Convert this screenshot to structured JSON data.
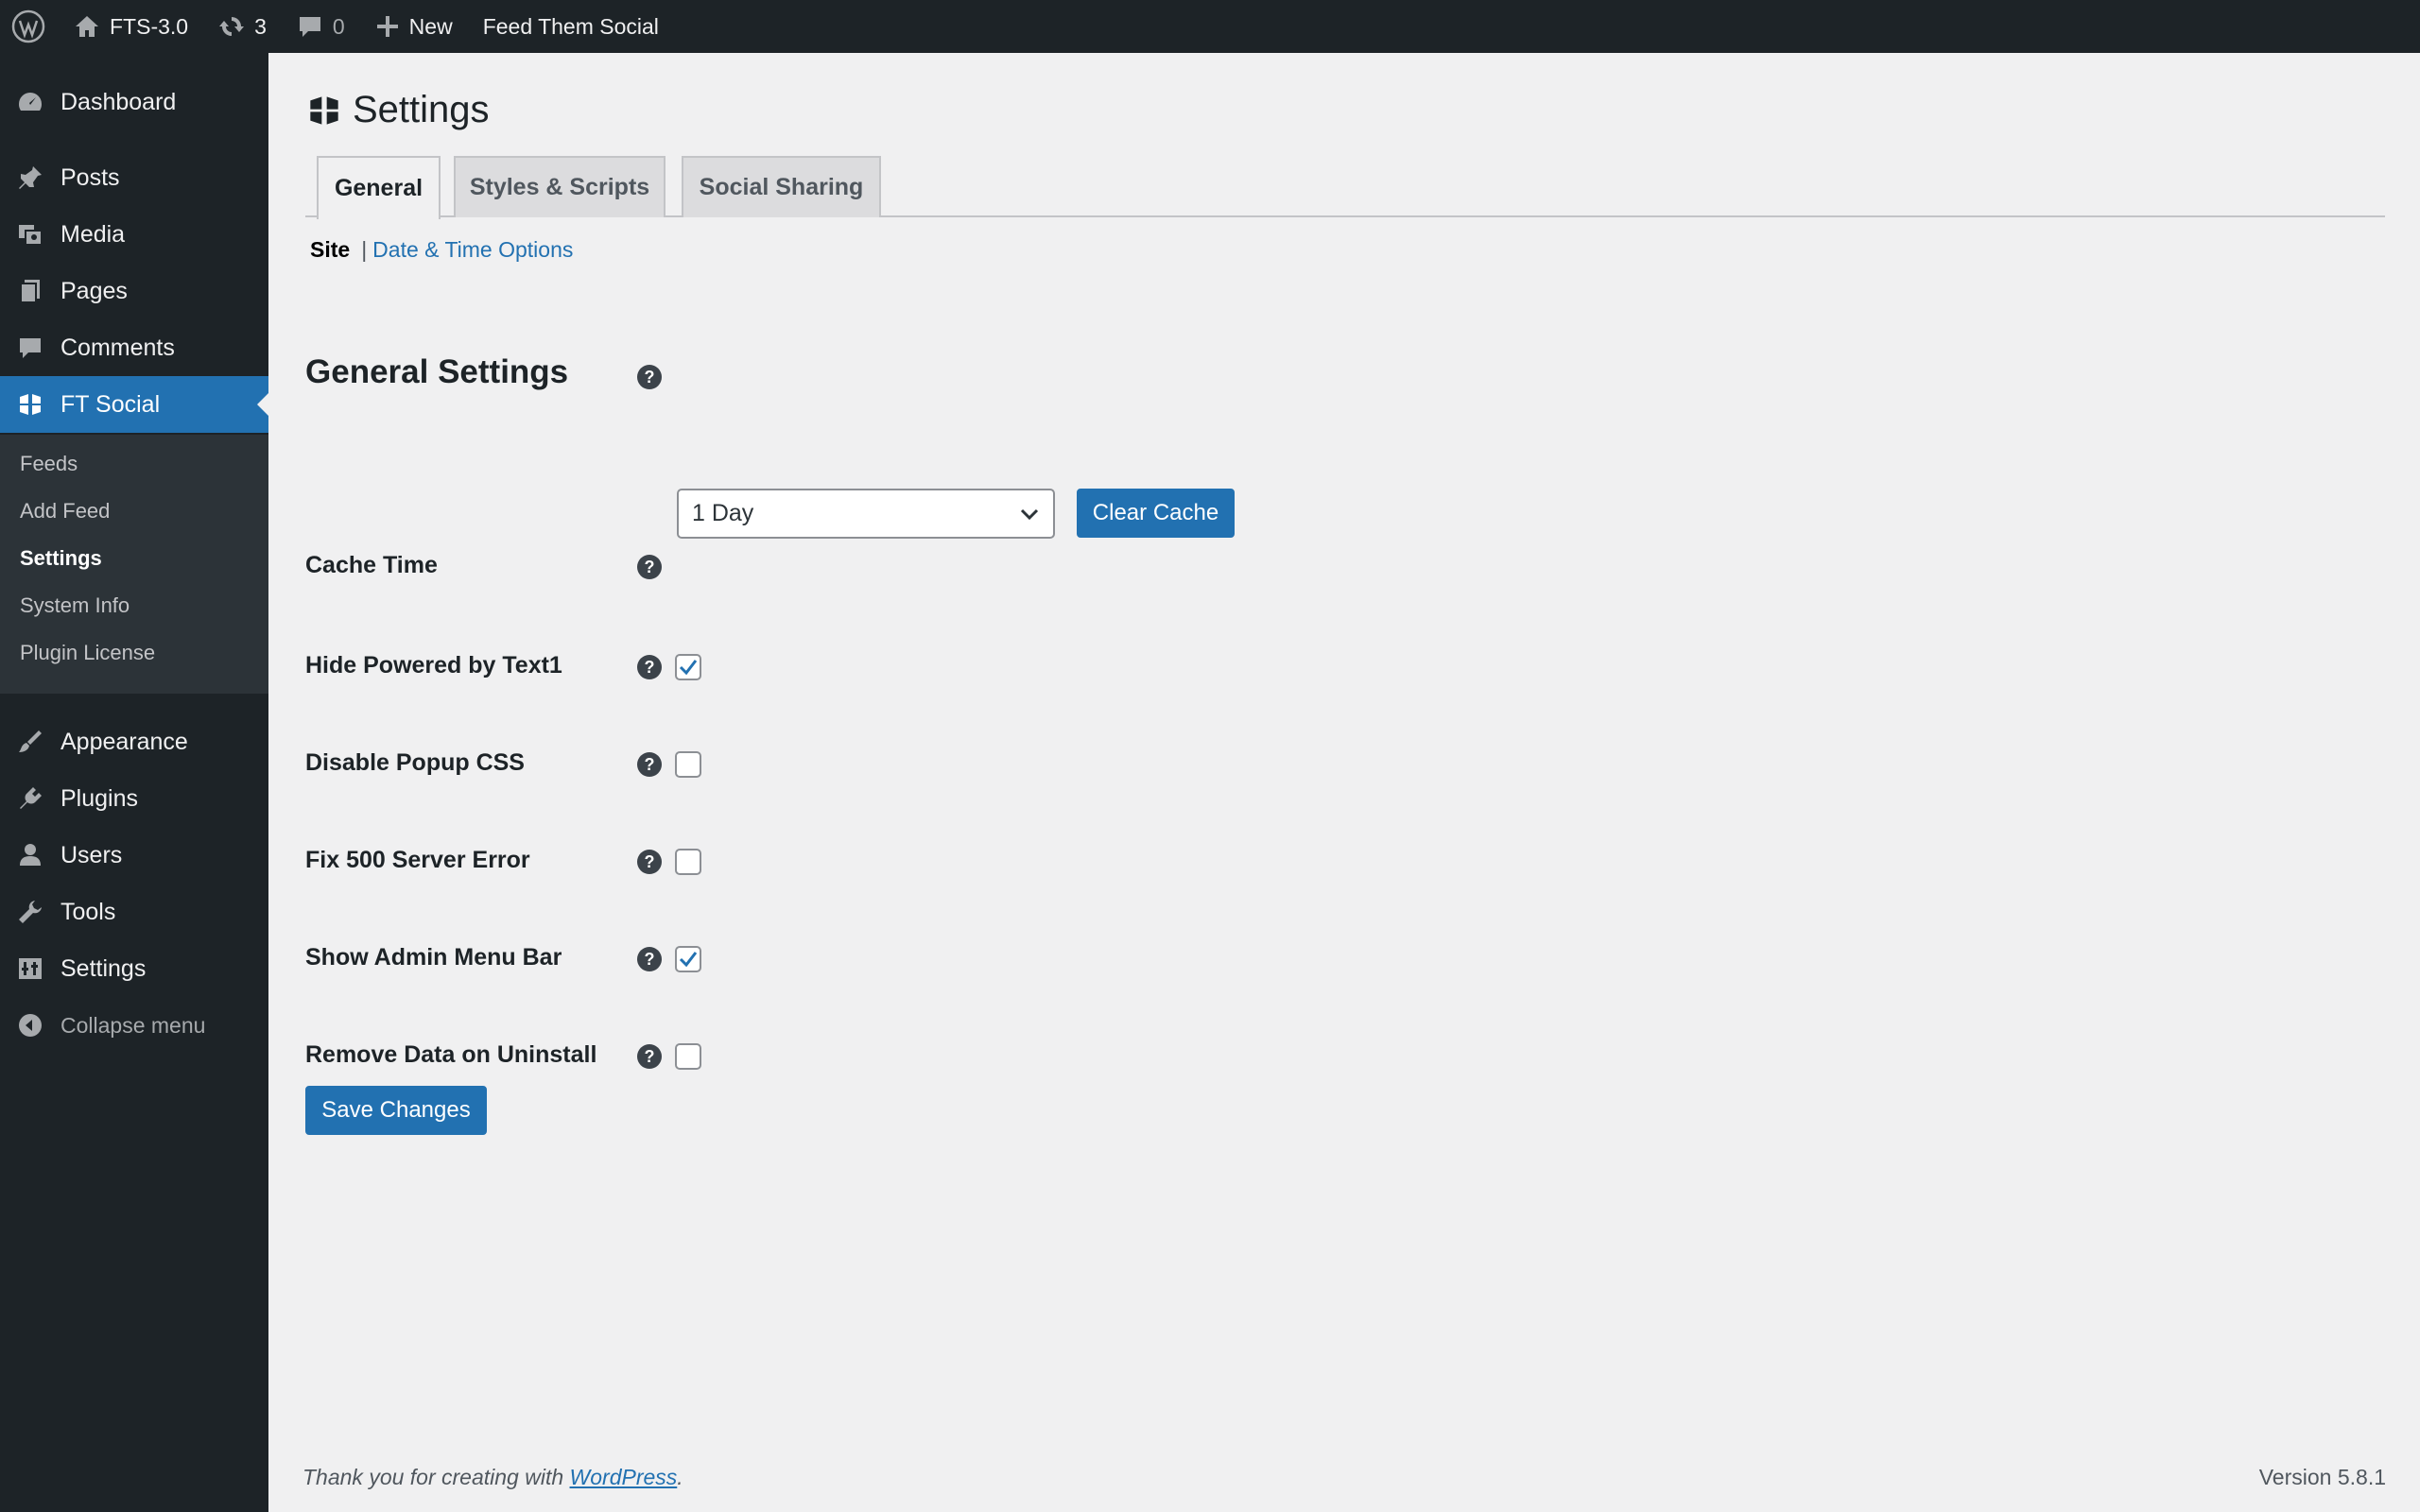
{
  "adminbar": {
    "site_name": "FTS-3.0",
    "updates_count": "3",
    "comments_count": "0",
    "new_label": "New",
    "plugin_label": "Feed Them Social"
  },
  "sidebar": {
    "items": [
      {
        "label": "Dashboard",
        "icon": "dashboard-icon"
      },
      {
        "label": "Posts",
        "icon": "pin-icon"
      },
      {
        "label": "Media",
        "icon": "media-icon"
      },
      {
        "label": "Pages",
        "icon": "pages-icon"
      },
      {
        "label": "Comments",
        "icon": "comment-icon"
      },
      {
        "label": "FT Social",
        "icon": "ft-social-icon"
      },
      {
        "label": "Appearance",
        "icon": "brush-icon"
      },
      {
        "label": "Plugins",
        "icon": "plugin-icon"
      },
      {
        "label": "Users",
        "icon": "user-icon"
      },
      {
        "label": "Tools",
        "icon": "wrench-icon"
      },
      {
        "label": "Settings",
        "icon": "settings-icon"
      },
      {
        "label": "Collapse menu",
        "icon": "collapse-icon"
      }
    ],
    "submenu": [
      "Feeds",
      "Add Feed",
      "Settings",
      "System Info",
      "Plugin License"
    ]
  },
  "page": {
    "title": "Settings",
    "tabs": [
      "General",
      "Styles & Scripts",
      "Social Sharing"
    ],
    "subnav": {
      "current": "Site",
      "separator": "|",
      "link": "Date & Time Options"
    },
    "section_title": "General Settings"
  },
  "form": {
    "cache_time": {
      "label": "Cache Time",
      "value": "1 Day"
    },
    "clear_cache_label": "Clear Cache",
    "rows": [
      {
        "label": "Hide Powered by Text1",
        "checked": true
      },
      {
        "label": "Disable Popup CSS",
        "checked": false
      },
      {
        "label": "Fix 500 Server Error",
        "checked": false
      },
      {
        "label": "Show Admin Menu Bar",
        "checked": true
      },
      {
        "label": "Remove Data on Uninstall",
        "checked": false
      }
    ],
    "help_glyph": "?",
    "save_label": "Save Changes"
  },
  "footer": {
    "thanks_prefix": "Thank you for creating with ",
    "thanks_link": "WordPress",
    "thanks_suffix": ".",
    "version": "Version 5.8.1"
  },
  "colors": {
    "accent": "#2271b1",
    "bar": "#1d2327",
    "background": "#f0f0f1"
  }
}
